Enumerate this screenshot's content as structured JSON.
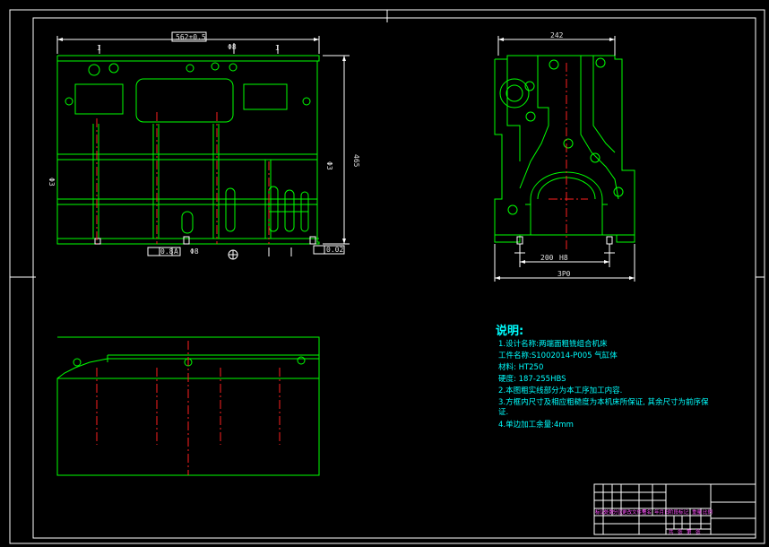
{
  "dimensions": {
    "front_width": "562±0.5",
    "front_top_callout": "Φ8",
    "front_height": "465",
    "front_right_callout": "Φ3",
    "front_left_callout": "Φ3",
    "front_bottom_callout": "Φ8",
    "front_tol_box1": "0.8",
    "front_tol_box1_datum": "A",
    "front_tol_box2": "0.02",
    "side_width": "242",
    "side_bore": "200",
    "side_bore_suffix": "H8",
    "side_base": "3P0"
  },
  "notes": {
    "title": "说明:",
    "lines": [
      "1.设计名称:两端面粗铣组合机床",
      "  工件名称:S1002014-P005 气缸体",
      "  材料:    HT250",
      "  硬度:     187-255HBS",
      "2.本图粗实线部分为本工序加工内容.",
      "3.方框内尺寸及相应粗糙度为本机床所保证, 其余尺寸为前序保",
      "  证.",
      "4.单边加工余量:4mm"
    ]
  },
  "title_block": {
    "row1": [
      "标记",
      "处数",
      "分区",
      "更改文件号",
      "签名",
      "年月日"
    ],
    "stage_labels": [
      "阶段标记",
      "重量",
      "比例"
    ],
    "row2": [
      "共",
      "张",
      "第",
      "张"
    ]
  }
}
